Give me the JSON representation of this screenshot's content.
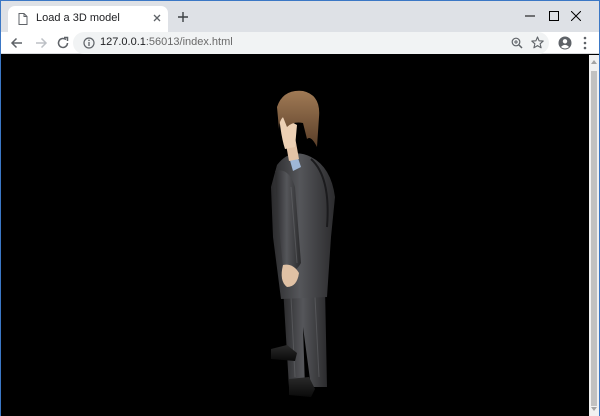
{
  "tab": {
    "title": "Load a 3D model"
  },
  "toolbar": {
    "url_host": "127.0.0.1",
    "url_rest": ":56013/index.html"
  },
  "colors": {
    "titlebar": "#dee1e6",
    "viewport": "#000000",
    "window_border": "#3b77c5"
  },
  "icons": {
    "tab_favicon": "page-icon",
    "tab_close": "close-icon",
    "new_tab": "plus-icon",
    "back": "arrow-left-icon",
    "forward": "arrow-right-icon",
    "reload": "reload-icon",
    "site_info": "info-icon",
    "zoom": "zoom-icon",
    "bookmark": "star-icon",
    "profile": "account-icon",
    "menu": "three-dots-icon"
  }
}
